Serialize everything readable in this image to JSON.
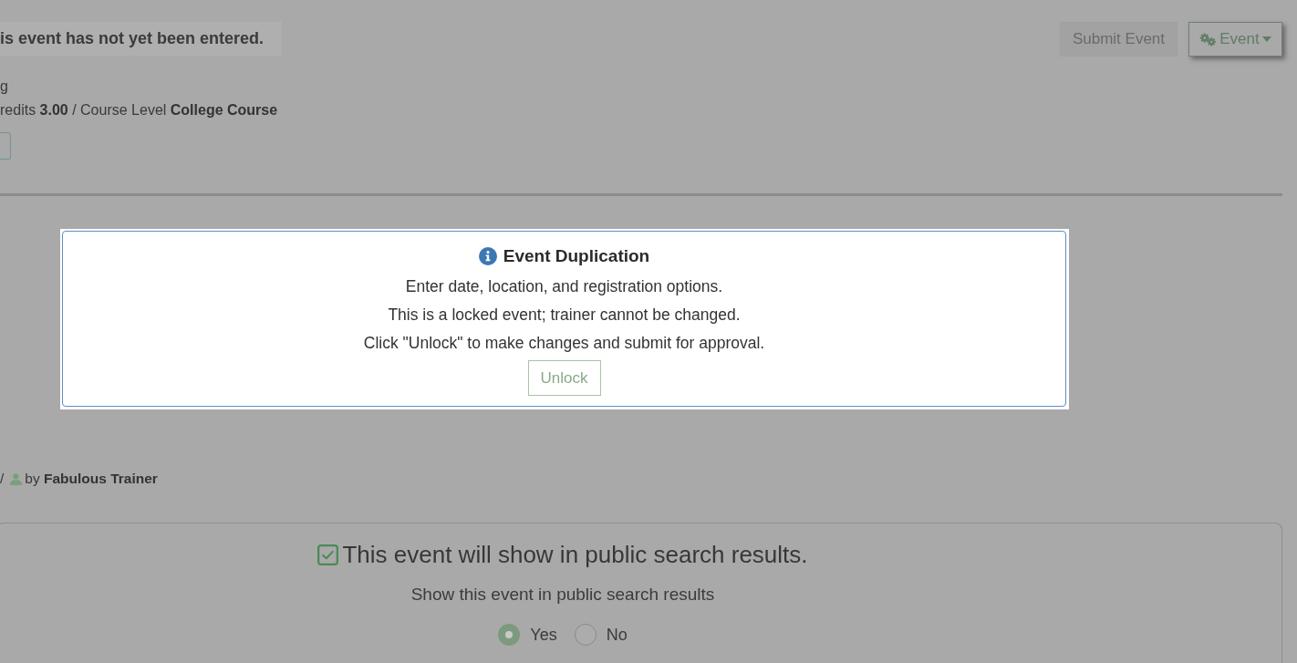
{
  "status_banner": {
    "text": "is event has not yet been entered."
  },
  "header_actions": [
    {
      "label": "Submit Event",
      "kind": "plain",
      "disabled": true
    },
    {
      "label": "Event",
      "kind": "menu",
      "disabled": false
    }
  ],
  "details": {
    "line_1": "g",
    "line_2": "redits **3.00** / Course Level **College Course**"
  },
  "modal": {
    "title": "Event Duplication",
    "lines": [
      "Enter date, location, and registration options.",
      "This is a locked event; trainer cannot be changed.",
      "Click \"Unlock\" to make changes and submit for approval."
    ],
    "button": "Unlock"
  },
  "trainer": {
    "separator": "/",
    "text": "by **Fabulous Trainer**"
  },
  "visibility_panel": {
    "heading": "This event will show in public search results.",
    "checked": true,
    "question": "Show this event in public search results",
    "options": [
      {
        "label": "Yes",
        "selected": true
      },
      {
        "label": "No",
        "selected": false
      }
    ]
  }
}
